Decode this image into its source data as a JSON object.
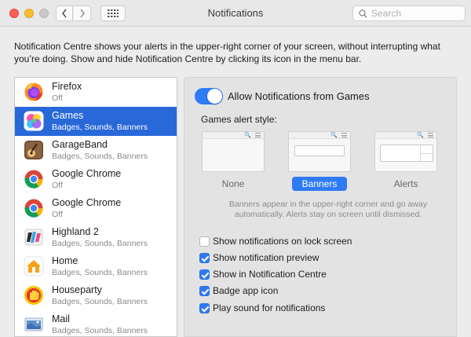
{
  "window": {
    "title": "Notifications",
    "search_placeholder": "Search"
  },
  "description": "Notification Centre shows your alerts in the upper-right corner of your screen, without interrupting what you’re doing. Show and hide Notification Centre by clicking its icon in the menu bar.",
  "apps": [
    {
      "name": "Firefox",
      "detail": "Off",
      "icon": "firefox-icon"
    },
    {
      "name": "Games",
      "detail": "Badges, Sounds, Banners",
      "icon": "games-icon",
      "selected": true
    },
    {
      "name": "GarageBand",
      "detail": "Badges, Sounds, Banners",
      "icon": "garageband-icon"
    },
    {
      "name": "Google Chrome",
      "detail": "Off",
      "icon": "chrome-icon"
    },
    {
      "name": "Google Chrome",
      "detail": "Off",
      "icon": "chrome-icon"
    },
    {
      "name": "Highland 2",
      "detail": "Badges, Sounds, Banners",
      "icon": "highland-icon"
    },
    {
      "name": "Home",
      "detail": "Badges, Sounds, Banners",
      "icon": "home-icon"
    },
    {
      "name": "Houseparty",
      "detail": "Badges, Sounds, Banners",
      "icon": "houseparty-icon"
    },
    {
      "name": "Mail",
      "detail": "Badges, Sounds, Banners",
      "icon": "mail-icon"
    }
  ],
  "detail": {
    "allow_label": "Allow Notifications from Games",
    "allow_enabled": true,
    "style_label": "Games alert style:",
    "styles": [
      {
        "label": "None"
      },
      {
        "label": "Banners",
        "selected": true
      },
      {
        "label": "Alerts"
      }
    ],
    "style_note": "Banners appear in the upper-right corner and go away automatically. Alerts stay on screen until dismissed.",
    "options": [
      {
        "label": "Show notifications on lock screen",
        "checked": false
      },
      {
        "label": "Show notification preview",
        "checked": true
      },
      {
        "label": "Show in Notification Centre",
        "checked": true
      },
      {
        "label": "Badge app icon",
        "checked": true
      },
      {
        "label": "Play sound for notifications",
        "checked": true
      }
    ]
  },
  "colors": {
    "selection": "#2868d9",
    "accent": "#2f7bf5"
  }
}
